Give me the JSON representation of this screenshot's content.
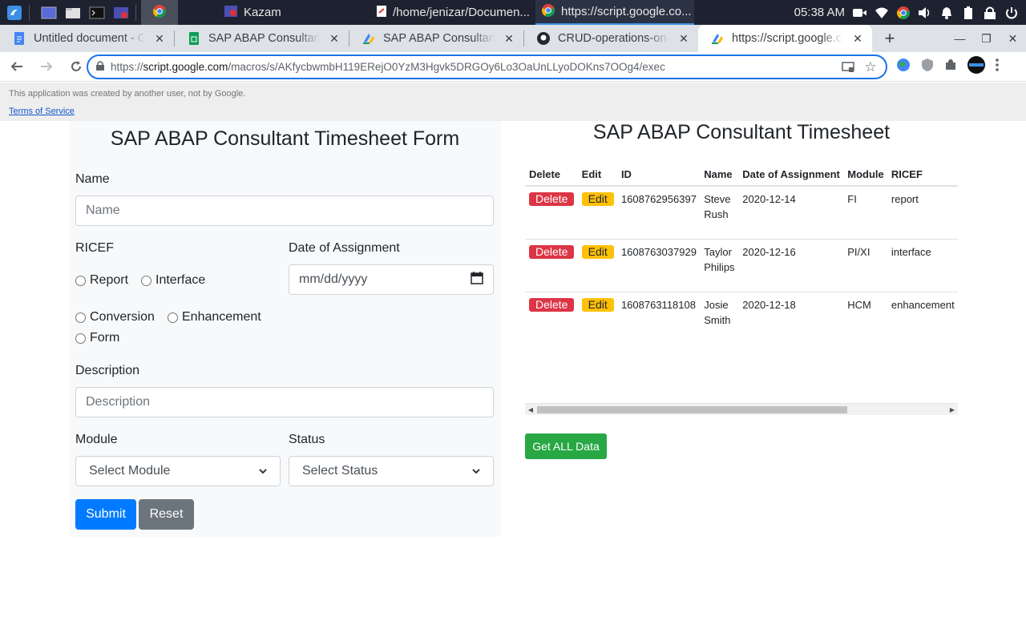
{
  "taskbar": {
    "windows": [
      {
        "label": "Kazam"
      },
      {
        "label": "/home/jenizar/Documen..."
      },
      {
        "label": "https://script.google.co..."
      }
    ],
    "clock": "05:38 AM"
  },
  "browser": {
    "tabs": [
      {
        "title": "Untitled document - Go"
      },
      {
        "title": "SAP ABAP Consultant T"
      },
      {
        "title": "SAP ABAP Consultant T"
      },
      {
        "title": "CRUD-operations-on-G"
      },
      {
        "title": "https://script.google.co"
      }
    ],
    "url": {
      "scheme": "https://",
      "host": "script.google.com",
      "path": "/macros/s/AKfycbwmbH119ERejO0YzM3Hgvk5DRGOy6Lo3OaUnLLyoDOKns7OOg4/exec"
    }
  },
  "gas": {
    "notice": "This application was created by another user, not by Google.",
    "terms": "Terms of Service"
  },
  "form": {
    "title": "SAP ABAP Consultant Timesheet Form",
    "name_label": "Name",
    "name_placeholder": "Name",
    "ricef_label": "RICEF",
    "ricef_options": [
      "Report",
      "Interface",
      "Conversion",
      "Enhancement",
      "Form"
    ],
    "date_label": "Date of Assignment",
    "date_placeholder": "mm/dd/yyyy",
    "description_label": "Description",
    "description_placeholder": "Description",
    "module_label": "Module",
    "module_selected": "Select Module",
    "status_label": "Status",
    "status_selected": "Select Status",
    "submit": "Submit",
    "reset": "Reset"
  },
  "timesheet": {
    "title": "SAP ABAP Consultant Timesheet",
    "columns": [
      "Delete",
      "Edit",
      "ID",
      "Name",
      "Date of Assignment",
      "Module",
      "RICEF"
    ],
    "delete_label": "Delete",
    "edit_label": "Edit",
    "rows": [
      {
        "id": "1608762956397",
        "name": "Steve Rush",
        "date": "2020-12-14",
        "module": "FI",
        "ricef": "report"
      },
      {
        "id": "1608763037929",
        "name": "Taylor Philips",
        "date": "2020-12-16",
        "module": "PI/XI",
        "ricef": "interface"
      },
      {
        "id": "1608763118108",
        "name": "Josie Smith",
        "date": "2020-12-18",
        "module": "HCM",
        "ricef": "enhancement"
      }
    ],
    "get_all": "Get ALL Data"
  },
  "colors": {
    "submit": "#007bff",
    "reset": "#6c757d",
    "delete": "#dc3545",
    "edit": "#ffc107",
    "get_all": "#28a745",
    "taskbar": "#1e2230"
  }
}
